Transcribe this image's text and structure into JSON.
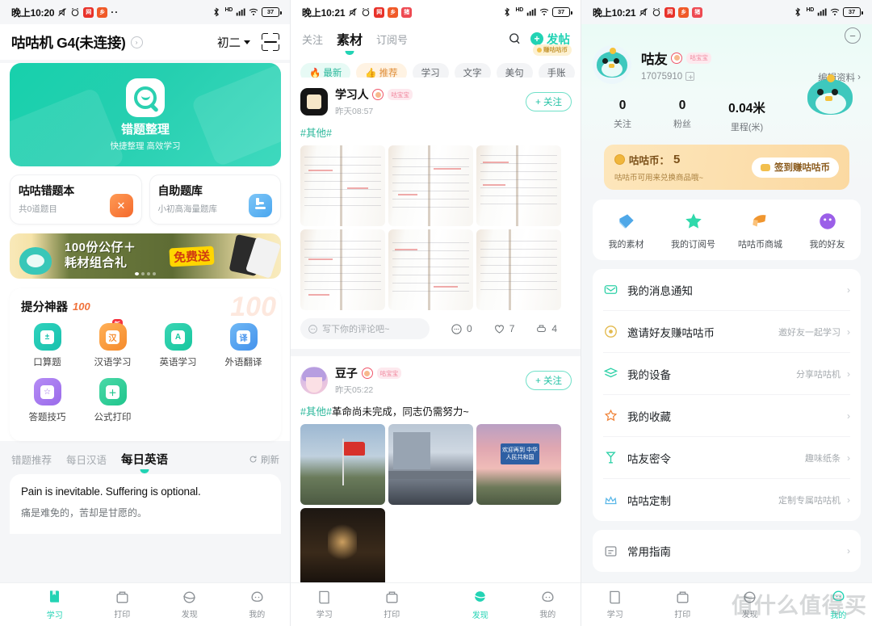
{
  "screen1": {
    "status": {
      "time": "晚上10:20",
      "battery": "37",
      "icons": [
        "mute-icon",
        "alarm-icon",
        "app-red-icon",
        "app-orange-icon",
        "more-dots"
      ]
    },
    "header": {
      "title": "咕咕机 G4(未连接)",
      "grade": "初二",
      "scan_icon": "scan-icon"
    },
    "hero": {
      "title": "错题整理",
      "subtitle": "快捷整理 高效学习"
    },
    "cards": [
      {
        "title": "咕咕错题本",
        "sub": "共0道题目",
        "icon": "wrong-question-icon"
      },
      {
        "title": "自助题库",
        "sub": "小初高海量题库",
        "icon": "question-bank-icon"
      }
    ],
    "banner": {
      "line1": "100份公仔＋",
      "line2": "耗材组合礼",
      "free": "免费送"
    },
    "tools_title": "提分神器",
    "tools_badge": "100",
    "tools": [
      {
        "label": "口算题",
        "glyph": "±",
        "color": "c-teal",
        "new": ""
      },
      {
        "label": "汉语学习",
        "glyph": "汉",
        "color": "c-org",
        "new": "新"
      },
      {
        "label": "英语学习",
        "glyph": "A",
        "color": "c-grn",
        "new": ""
      },
      {
        "label": "外语翻译",
        "glyph": "译",
        "color": "c-blue",
        "new": ""
      },
      {
        "label": "答题技巧",
        "glyph": "☆",
        "color": "c-pur",
        "new": ""
      },
      {
        "label": "公式打印",
        "glyph": "＋",
        "color": "c-grn2",
        "new": ""
      }
    ],
    "subtabs": [
      {
        "label": "错题推荐",
        "active": false
      },
      {
        "label": "每日汉语",
        "active": false
      },
      {
        "label": "每日英语",
        "active": true
      }
    ],
    "refresh": "刷新",
    "quote": {
      "en": "Pain is inevitable. Suffering is optional.",
      "cn": "痛是难免的，苦却是甘愿的。"
    },
    "tabbar": [
      {
        "label": "学习",
        "icon": "study-icon",
        "active": true
      },
      {
        "label": "打印",
        "icon": "print-icon",
        "active": false
      },
      {
        "label": "发现",
        "icon": "discover-icon",
        "active": false
      },
      {
        "label": "我的",
        "icon": "profile-icon",
        "active": false
      }
    ]
  },
  "screen2": {
    "status": {
      "time": "晚上10:21",
      "battery": "37"
    },
    "tabs": [
      {
        "label": "关注",
        "active": false
      },
      {
        "label": "素材",
        "active": true
      },
      {
        "label": "订阅号",
        "active": false
      }
    ],
    "search_icon": "search-icon",
    "post_button": "发帖",
    "earn_badge": "赚咕咕币",
    "chips": [
      {
        "label": "最新",
        "style": "hot",
        "icon": "flame-icon"
      },
      {
        "label": "推荐",
        "style": "rec",
        "icon": "thumb-icon"
      },
      {
        "label": "学习",
        "style": "",
        "icon": ""
      },
      {
        "label": "文字",
        "style": "",
        "icon": ""
      },
      {
        "label": "美句",
        "style": "",
        "icon": ""
      },
      {
        "label": "手账",
        "style": "",
        "icon": ""
      }
    ],
    "posts": [
      {
        "name": "学习人",
        "badge": "咕宝宝",
        "time": "昨天08:57",
        "follow": "+ 关注",
        "tag": "#其他#",
        "text": "",
        "comment_placeholder": "写下你的评论吧~",
        "comments": "0",
        "likes": "7",
        "prints": "4"
      },
      {
        "name": "豆子",
        "badge": "咕宝宝",
        "time": "昨天05:22",
        "follow": "+ 关注",
        "tag": "#其他#",
        "text": "革命尚未完成，同志仍需努力~",
        "sign_text": "欢迎再到 中华人民共和国"
      }
    ],
    "tabbar": [
      {
        "label": "学习",
        "active": false
      },
      {
        "label": "打印",
        "active": false
      },
      {
        "label": "发现",
        "active": true
      },
      {
        "label": "我的",
        "active": false
      }
    ]
  },
  "screen3": {
    "status": {
      "time": "晚上10:21",
      "battery": "37"
    },
    "profile": {
      "name": "咕友",
      "badge": "咕宝宝",
      "uid": "17075910",
      "edit": "编辑资料"
    },
    "stats": [
      {
        "value": "0",
        "label": "关注"
      },
      {
        "value": "0",
        "label": "粉丝"
      },
      {
        "value": "0.04米",
        "label": "里程(米)"
      }
    ],
    "coin": {
      "title": "咕咕币：",
      "amount": "5",
      "sub": "咕咕币可用来兑换商品哦~",
      "button": "签到赚咕咕币"
    },
    "quick": [
      {
        "label": "我的素材",
        "icon": "material-icon"
      },
      {
        "label": "我的订阅号",
        "icon": "star-icon"
      },
      {
        "label": "咕咕币商城",
        "icon": "shop-icon"
      },
      {
        "label": "我的好友",
        "icon": "friends-icon"
      }
    ],
    "rows": [
      {
        "label": "我的消息通知",
        "hint": "",
        "icon": "mail-icon"
      },
      {
        "label": "邀请好友赚咕咕币",
        "hint": "邀好友一起学习",
        "icon": "invite-icon"
      },
      {
        "label": "我的设备",
        "hint": "分享咕咕机",
        "icon": "device-icon"
      },
      {
        "label": "我的收藏",
        "hint": "",
        "icon": "star-outline-icon"
      },
      {
        "label": "咕友密令",
        "hint": "趣味纸条",
        "icon": "code-icon"
      },
      {
        "label": "咕咕定制",
        "hint": "定制专属咕咕机",
        "icon": "custom-icon"
      }
    ],
    "rows2": [
      {
        "label": "常用指南",
        "hint": "",
        "icon": "guide-icon"
      }
    ],
    "tabbar": [
      {
        "label": "学习",
        "active": false
      },
      {
        "label": "打印",
        "active": false
      },
      {
        "label": "发现",
        "active": false
      },
      {
        "label": "我的",
        "active": true
      }
    ],
    "watermark": "值什么值得买"
  },
  "colors": {
    "accent": "#22d3b4",
    "orange": "#f4692c",
    "coin": "#f0b63c",
    "red": "#f0566a"
  }
}
